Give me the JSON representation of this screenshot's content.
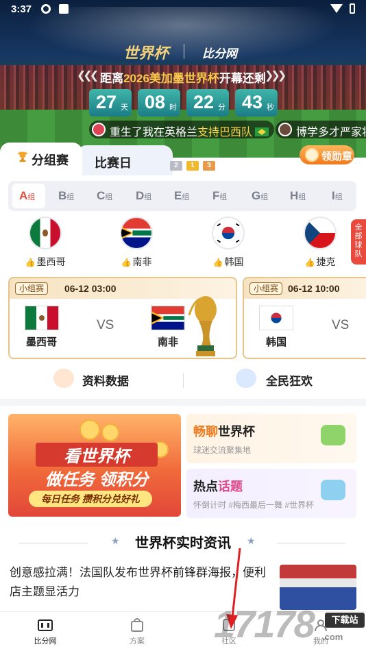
{
  "status_bar": {
    "time": "3:37"
  },
  "hero": {
    "logo_world_cup": "世界杯",
    "logo_app": "比分网",
    "countdown_prefix": "距离",
    "countdown_highlight": "2026美加墨世界杯",
    "countdown_suffix": "开幕还剩",
    "countdown": [
      {
        "value": "27",
        "unit": "天"
      },
      {
        "value": "08",
        "unit": "时"
      },
      {
        "value": "22",
        "unit": "分"
      },
      {
        "value": "43",
        "unit": "秒"
      }
    ],
    "ticker": [
      {
        "prefix": "重生了我在英格兰",
        "highlight": "支持巴西队"
      },
      {
        "prefix": "博学多才严家将",
        "highlight": ""
      }
    ]
  },
  "tabs": {
    "group_stage": "分组赛",
    "match_day": "比赛日",
    "ranks": [
      "2",
      "1",
      "3"
    ]
  },
  "medal_button": "领勋章",
  "groups": [
    {
      "letter": "A",
      "suffix": "组"
    },
    {
      "letter": "B",
      "suffix": "组"
    },
    {
      "letter": "C",
      "suffix": "组"
    },
    {
      "letter": "D",
      "suffix": "组"
    },
    {
      "letter": "E",
      "suffix": "组"
    },
    {
      "letter": "F",
      "suffix": "组"
    },
    {
      "letter": "G",
      "suffix": "组"
    },
    {
      "letter": "H",
      "suffix": "组"
    },
    {
      "letter": "I",
      "suffix": "组"
    }
  ],
  "teams": [
    {
      "name": "墨西哥",
      "flag": "mexico-flag"
    },
    {
      "name": "南非",
      "flag": "south-africa-flag"
    },
    {
      "name": "韩国",
      "flag": "korea-flag"
    },
    {
      "name": "捷克",
      "flag": "czech-flag"
    }
  ],
  "all_teams_tab": [
    "全",
    "部",
    "球",
    "队"
  ],
  "matches": [
    {
      "tag": "小组赛",
      "datetime": "06-12 03:00",
      "home": "墨西哥",
      "away": "南非",
      "vs": "VS"
    },
    {
      "tag": "小组赛",
      "datetime": "06-12 10:00",
      "home": "韩国",
      "away": "",
      "vs": "VS"
    }
  ],
  "quick_links": {
    "data": "资料数据",
    "carnival": "全民狂欢"
  },
  "promo": {
    "big_line1": "看世界杯",
    "big_line2": "做任务 领积分",
    "big_line3": "每日任务 攒积分兑好礼",
    "chat_title_a": "畅聊",
    "chat_title_b": "世界杯",
    "chat_sub": "球迷交流聚集地",
    "hot_title_a": "热点",
    "hot_title_b": "话题",
    "hot_sub": "怀倒计时 #梅西最后一舞 #世界杯"
  },
  "news": {
    "section_title": "世界杯实时资讯",
    "headline": "创意感拉满！法国队发布世界杯前锋群海报，便利店主题显活力"
  },
  "bottom_nav": [
    "比分网",
    "方案",
    "社区",
    "我的"
  ],
  "watermark": {
    "digits": "17178",
    "badge": "下载站",
    "site": ".com"
  },
  "colors": {
    "accent_red": "#e24a3b",
    "accent_orange": "#f07a1d",
    "countdown_teal": "#1b7d86"
  }
}
